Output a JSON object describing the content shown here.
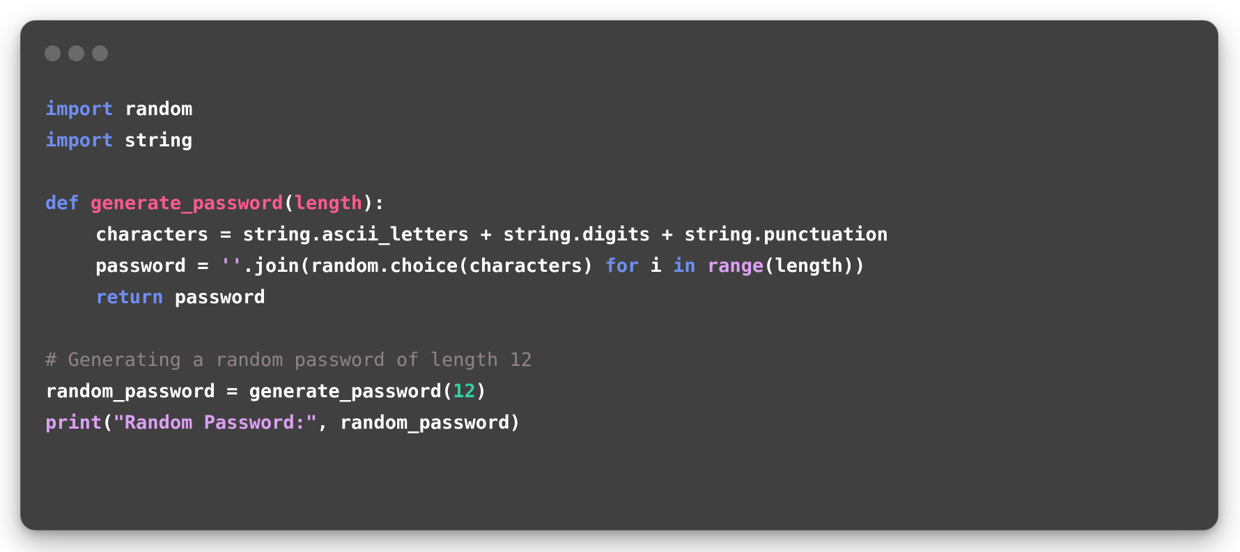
{
  "window": {
    "background": "#404040",
    "dots_color": "#6a6a6a"
  },
  "colors": {
    "keyword": "#6f8ff5",
    "function_name": "#ff5b8f",
    "builtin": "#dda0f4",
    "number": "#33d1a2",
    "comment": "#908487",
    "plain": "#ffffff"
  },
  "code": {
    "language": "python",
    "lines": [
      {
        "tokens": [
          {
            "type": "keyword",
            "text": "import"
          },
          {
            "type": "plain",
            "text": " random"
          }
        ]
      },
      {
        "tokens": [
          {
            "type": "keyword",
            "text": "import"
          },
          {
            "type": "plain",
            "text": " string"
          }
        ]
      },
      {
        "tokens": []
      },
      {
        "tokens": [
          {
            "type": "keyword",
            "text": "def"
          },
          {
            "type": "plain",
            "text": " "
          },
          {
            "type": "funcname",
            "text": "generate_password"
          },
          {
            "type": "plain",
            "text": "("
          },
          {
            "type": "funcname",
            "text": "length"
          },
          {
            "type": "plain",
            "text": "):"
          }
        ]
      },
      {
        "indent": 1,
        "tokens": [
          {
            "type": "plain",
            "text": "characters = string.ascii_letters + string.digits + string.punctuation"
          }
        ]
      },
      {
        "indent": 1,
        "tokens": [
          {
            "type": "plain",
            "text": "password = "
          },
          {
            "type": "string",
            "text": "''"
          },
          {
            "type": "plain",
            "text": ".join(random.choice(characters) "
          },
          {
            "type": "keyword",
            "text": "for"
          },
          {
            "type": "plain",
            "text": " i "
          },
          {
            "type": "keyword",
            "text": "in"
          },
          {
            "type": "plain",
            "text": " "
          },
          {
            "type": "builtin",
            "text": "range"
          },
          {
            "type": "plain",
            "text": "(length))"
          }
        ]
      },
      {
        "indent": 1,
        "tokens": [
          {
            "type": "keyword",
            "text": "return"
          },
          {
            "type": "plain",
            "text": " password"
          }
        ]
      },
      {
        "tokens": []
      },
      {
        "tokens": [
          {
            "type": "comment",
            "text": "# Generating a random password of length 12"
          }
        ]
      },
      {
        "tokens": [
          {
            "type": "plain",
            "text": "random_password = generate_password("
          },
          {
            "type": "number",
            "text": "12"
          },
          {
            "type": "plain",
            "text": ")"
          }
        ]
      },
      {
        "tokens": [
          {
            "type": "builtin",
            "text": "print"
          },
          {
            "type": "plain",
            "text": "("
          },
          {
            "type": "string",
            "text": "\"Random Password:\""
          },
          {
            "type": "plain",
            "text": ", random_password)"
          }
        ]
      }
    ]
  }
}
